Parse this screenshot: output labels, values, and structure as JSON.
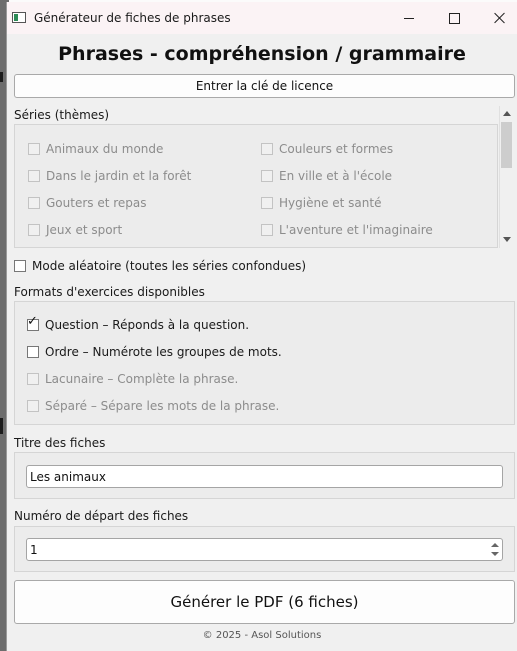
{
  "window": {
    "title": "Générateur de fiches de phrases"
  },
  "header": {
    "title": "Phrases - compréhension / grammaire"
  },
  "license_button": {
    "label": "Entrer la clé de licence"
  },
  "series": {
    "label": "Séries (thèmes)",
    "items": [
      "Animaux du monde",
      "Couleurs et formes",
      "Dans le jardin et la forêt",
      "En ville et à l'école",
      "Gouters et repas",
      "Hygiène et santé",
      "Jeux et sport",
      "L'aventure et l'imaginaire"
    ]
  },
  "random_mode": {
    "label": "Mode aléatoire (toutes les séries confondues)",
    "checked": false
  },
  "formats": {
    "label": "Formats d'exercices disponibles",
    "items": [
      {
        "label": "Question – Réponds à la question.",
        "checked": true,
        "enabled": true
      },
      {
        "label": "Ordre – Numérote les groupes de mots.",
        "checked": false,
        "enabled": true
      },
      {
        "label": "Lacunaire – Complète la phrase.",
        "checked": false,
        "enabled": false
      },
      {
        "label": "Séparé – Sépare les mots de la phrase.",
        "checked": false,
        "enabled": false
      }
    ]
  },
  "title_field": {
    "label": "Titre des fiches",
    "value": "Les animaux"
  },
  "start_number": {
    "label": "Numéro de départ des fiches",
    "value": "1"
  },
  "generate_button": {
    "label": "Générer le PDF (6 fiches)"
  },
  "footer": {
    "text": "© 2025 - Asol Solutions"
  }
}
